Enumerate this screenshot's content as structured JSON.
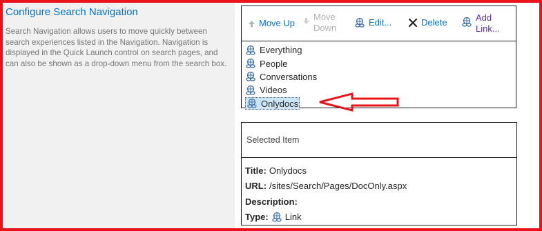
{
  "section": {
    "title": "Configure Search Navigation",
    "description": "Search Navigation allows users to move quickly between search experiences listed in the Navigation. Navigation is displayed in the Quick Launch control on search pages, and can also be shown as a drop-down menu from the search box."
  },
  "toolbar": {
    "move_up": "Move Up",
    "move_down": "Move Down",
    "edit": "Edit...",
    "delete": "Delete",
    "add_link": "Add Link..."
  },
  "nav_items": [
    {
      "label": "Everything",
      "icon": "link-icon"
    },
    {
      "label": "People",
      "icon": "link-icon"
    },
    {
      "label": "Conversations",
      "icon": "link-icon"
    },
    {
      "label": "Videos",
      "icon": "link-icon"
    },
    {
      "label": "Onlydocs",
      "icon": "link-icon",
      "selected": true
    }
  ],
  "selected_item": {
    "header": "Selected Item",
    "title_label": "Title:",
    "title_value": "Onlydocs",
    "url_label": "URL:",
    "url_value": "/sites/Search/Pages/DocOnly.aspx",
    "description_label": "Description:",
    "description_value": "",
    "type_label": "Type:",
    "type_value": "Link"
  },
  "colors": {
    "annotation_red": "#e8141a",
    "link_blue": "#0072c6",
    "add_link_purple": "#5c2d91",
    "selection_bg": "#cde6f7"
  }
}
